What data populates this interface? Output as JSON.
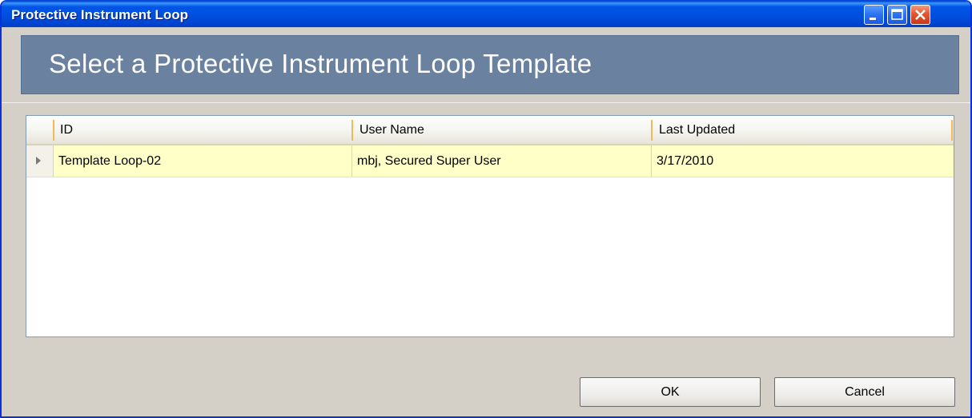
{
  "window": {
    "title": "Protective Instrument Loop"
  },
  "titlebar_buttons": [
    "minimize-icon",
    "maximize-icon",
    "close-icon"
  ],
  "header": {
    "title": "Select a Protective Instrument Loop Template"
  },
  "grid": {
    "columns": [
      "ID",
      "User Name",
      "Last Updated"
    ],
    "rows": [
      {
        "id": "Template Loop-02",
        "user_name": "mbj, Secured Super User",
        "last_updated": "3/17/2010"
      }
    ]
  },
  "buttons": {
    "ok": "OK",
    "cancel": "Cancel"
  },
  "colors": {
    "titlebar": "#0055e5",
    "banner": "#6a829f",
    "selected_row": "#ffffc8",
    "client_bg": "#d4d0c8"
  }
}
